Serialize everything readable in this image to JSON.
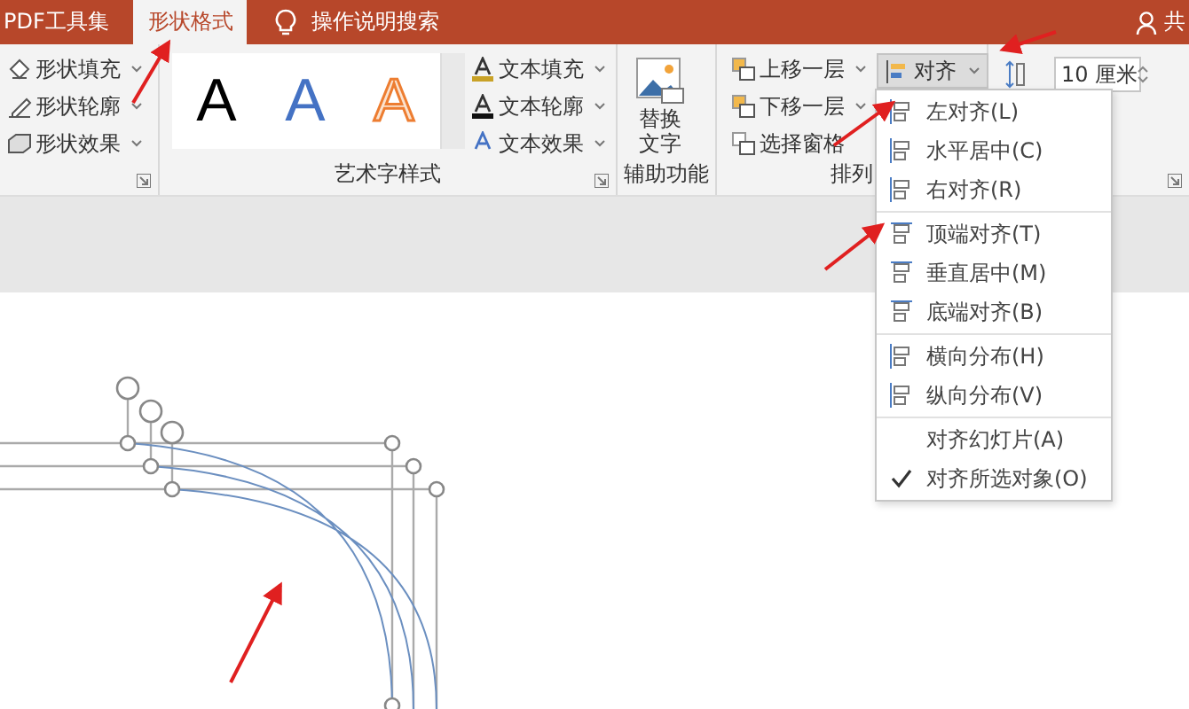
{
  "title_bar": {
    "tabs": [
      {
        "label": "PDF工具集",
        "selected": false
      },
      {
        "label": "形状格式",
        "selected": true
      }
    ],
    "tell_me": "操作说明搜索",
    "share": "共"
  },
  "ribbon": {
    "shape_styles": {
      "items": [
        "形状填充",
        "形状轮廓",
        "形状效果"
      ]
    },
    "wordart_styles": {
      "samples": [
        {
          "letter": "A",
          "kind": "black"
        },
        {
          "letter": "A",
          "kind": "blue"
        },
        {
          "letter": "A",
          "kind": "orange-outline"
        }
      ],
      "items": [
        "文本填充",
        "文本轮廓",
        "文本效果"
      ],
      "label": "艺术字样式"
    },
    "accessibility": {
      "button": [
        "替换",
        "文字"
      ],
      "label": "辅助功能"
    },
    "arrange": {
      "items": [
        "上移一层",
        "下移一层",
        "选择窗格"
      ],
      "align_button": {
        "label": "对齐",
        "expanded": true
      },
      "label": "排列"
    },
    "size": {
      "height": "10 厘米"
    }
  },
  "align_menu": {
    "sections": [
      [
        {
          "label": "左对齐(L)",
          "kind": "align"
        },
        {
          "label": "水平居中(C)",
          "kind": "align"
        },
        {
          "label": "右对齐(R)",
          "kind": "align"
        }
      ],
      [
        {
          "label": "顶端对齐(T)",
          "kind": "align"
        },
        {
          "label": "垂直居中(M)",
          "kind": "align"
        },
        {
          "label": "底端对齐(B)",
          "kind": "align"
        }
      ],
      [
        {
          "label": "横向分布(H)",
          "kind": "align"
        },
        {
          "label": "纵向分布(V)",
          "kind": "align"
        }
      ],
      [
        {
          "label": "对齐幻灯片(A)",
          "kind": "toggle",
          "checked": false
        },
        {
          "label": "对齐所选对象(O)",
          "kind": "toggle",
          "checked": true
        }
      ]
    ]
  }
}
